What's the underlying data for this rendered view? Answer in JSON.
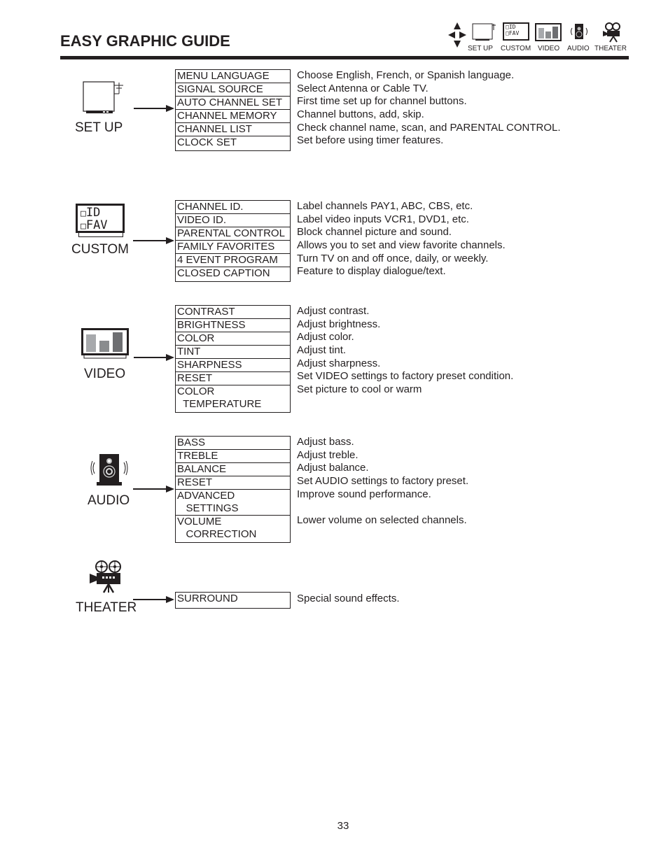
{
  "header": {
    "title": "EASY GRAPHIC GUIDE",
    "nav_icons": [
      {
        "icon": "navigation-arrows-icon",
        "label": ""
      },
      {
        "icon": "setup-tv-icon",
        "label": "SET UP"
      },
      {
        "icon": "custom-id-fav-icon",
        "label": "CUSTOM"
      },
      {
        "icon": "video-bars-icon",
        "label": "VIDEO"
      },
      {
        "icon": "audio-speaker-icon",
        "label": "AUDIO"
      },
      {
        "icon": "theater-camera-icon",
        "label": "THEATER"
      }
    ]
  },
  "sections": [
    {
      "name": "SET UP",
      "icon": "setup-tv-icon",
      "items": [
        {
          "label": "MENU LANGUAGE",
          "desc": "Choose English, French, or Spanish language."
        },
        {
          "label": "SIGNAL SOURCE",
          "desc": "Select Antenna or Cable TV."
        },
        {
          "label": "AUTO CHANNEL SET",
          "desc": "First time set up for channel buttons."
        },
        {
          "label": "CHANNEL MEMORY",
          "desc": "Channel buttons, add, skip."
        },
        {
          "label": "CHANNEL LIST",
          "desc": "Check channel name, scan, and PARENTAL CONTROL."
        },
        {
          "label": "CLOCK SET",
          "desc": "Set before using timer features."
        }
      ]
    },
    {
      "name": "CUSTOM",
      "icon": "custom-id-fav-icon",
      "icon_text": [
        "ID",
        "FAV"
      ],
      "items": [
        {
          "label": "CHANNEL ID.",
          "desc": "Label channels PAY1, ABC, CBS, etc."
        },
        {
          "label": "VIDEO ID.",
          "desc": "Label video inputs VCR1, DVD1, etc."
        },
        {
          "label": "PARENTAL CONTROL",
          "desc": "Block channel picture and sound."
        },
        {
          "label": "FAMILY FAVORITES",
          "desc": "Allows you to set and view favorite channels."
        },
        {
          "label": "4 EVENT PROGRAM",
          "desc": "Turn TV on and off once, daily, or weekly."
        },
        {
          "label": "CLOSED CAPTION",
          "desc": "Feature to display dialogue/text."
        }
      ]
    },
    {
      "name": "VIDEO",
      "icon": "video-bars-icon",
      "items": [
        {
          "label": "CONTRAST",
          "desc": "Adjust contrast."
        },
        {
          "label": "BRIGHTNESS",
          "desc": "Adjust brightness."
        },
        {
          "label": "COLOR",
          "desc": "Adjust color."
        },
        {
          "label": "TINT",
          "desc": "Adjust tint."
        },
        {
          "label": "SHARPNESS",
          "desc": "Adjust sharpness."
        },
        {
          "label": "RESET",
          "desc": "Set VIDEO settings to factory preset condition."
        },
        {
          "label": "COLOR\n  TEMPERATURE",
          "desc": "Set picture to cool or warm"
        }
      ]
    },
    {
      "name": "AUDIO",
      "icon": "audio-speaker-icon",
      "items": [
        {
          "label": "BASS",
          "desc": "Adjust bass."
        },
        {
          "label": "TREBLE",
          "desc": "Adjust treble."
        },
        {
          "label": "BALANCE",
          "desc": "Adjust balance."
        },
        {
          "label": "RESET",
          "desc": "Set AUDIO settings to factory preset."
        },
        {
          "label": "ADVANCED\n   SETTINGS",
          "desc": "Improve sound performance."
        },
        {
          "label": "VOLUME\n   CORRECTION",
          "desc": "Lower volume on selected channels."
        }
      ]
    },
    {
      "name": "THEATER",
      "icon": "theater-camera-icon",
      "items": [
        {
          "label": "SURROUND",
          "desc": "Special sound effects."
        }
      ]
    }
  ],
  "footer": {
    "page_number": "33"
  }
}
